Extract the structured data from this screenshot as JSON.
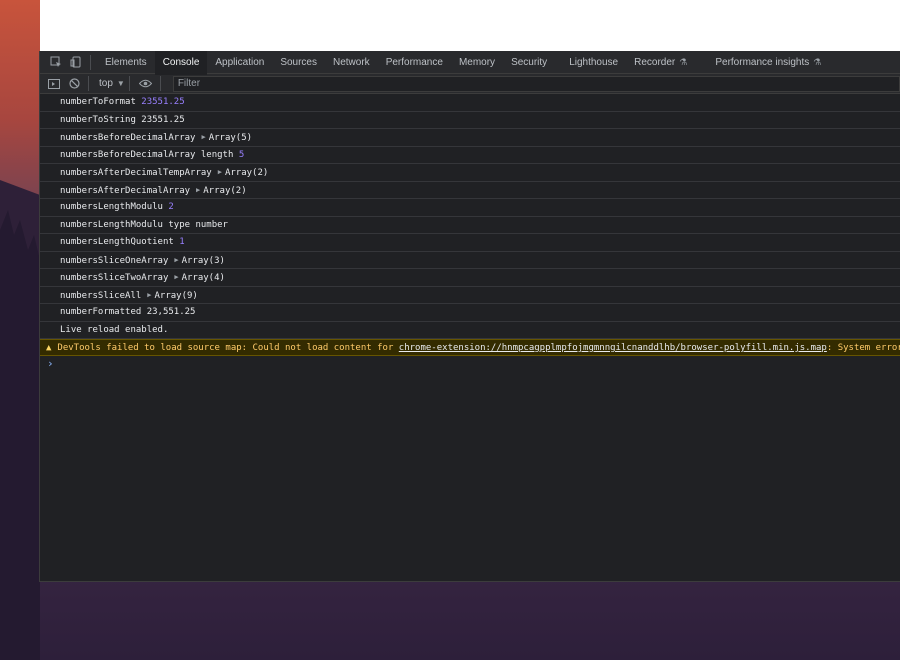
{
  "toolbar": {
    "tabs": [
      "Elements",
      "Console",
      "Application",
      "Sources",
      "Network",
      "Performance",
      "Memory",
      "Security",
      "Lighthouse",
      "Recorder",
      "Performance insights"
    ]
  },
  "filterbar": {
    "context": "top",
    "filter_placeholder": "Filter"
  },
  "console": {
    "rows": [
      {
        "label": "numberToFormat",
        "value": "23551.25"
      },
      {
        "label": "numberToString",
        "value": "23551.25"
      },
      {
        "label": "numbersBeforeDecimalArray",
        "value": "Array(5)"
      },
      {
        "label": "numbersBeforeDecimalArray length",
        "value": "5"
      },
      {
        "label": "numbersAfterDecimalTempArray",
        "value": "Array(2)"
      },
      {
        "label": "numbersAfterDecimalArray",
        "value": "Array(2)"
      },
      {
        "label": "numbersLengthModulu",
        "value": "2"
      },
      {
        "label": "numbersLengthModulu type number",
        "value": ""
      },
      {
        "label": "numbersLengthQuotient",
        "value": "1"
      },
      {
        "label": "numbersSliceOneArray",
        "value": "Array(3)"
      },
      {
        "label": "numbersSliceTwoArray",
        "value": "Array(4)"
      },
      {
        "label": "numbersSliceAll",
        "value": "Array(9)"
      },
      {
        "label": "numberFormatted",
        "value": "23,551.25"
      },
      {
        "label": "Live reload enabled.",
        "value": ""
      }
    ],
    "warning": {
      "prefix": "DevTools failed to load source map: Could not load content for ",
      "link": "chrome-extension://hnmpcagpplmpfojmgmnngilcnanddlhb/browser-polyfill.min.js.map",
      "suffix": ": System error: ne"
    },
    "prompt": "›"
  },
  "colors": {
    "panel_bg": "#202124",
    "number": "#9980ff",
    "warning_text": "#ffcb6b",
    "warning_bg": "#332b00"
  }
}
